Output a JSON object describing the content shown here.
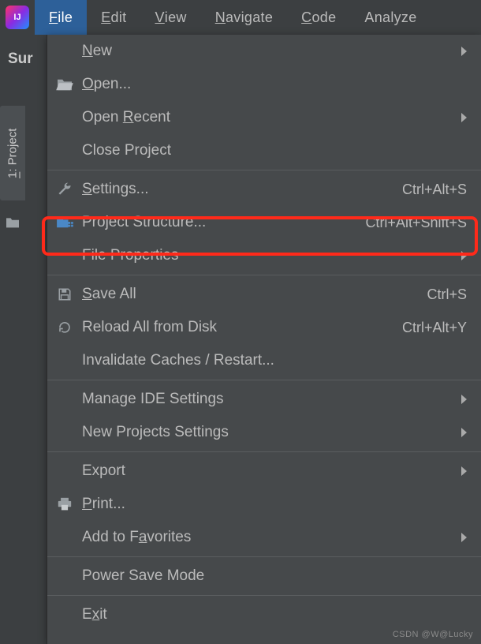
{
  "app": {
    "logo_text": "IJ"
  },
  "menubar": {
    "file_u": "F",
    "file_r": "ile",
    "edit_u": "E",
    "edit_r": "dit",
    "view_u": "V",
    "view_r": "iew",
    "nav_u": "N",
    "nav_r": "avigate",
    "code_u": "C",
    "code_r": "ode",
    "analyze": "Analyze"
  },
  "sidebar": {
    "truncated_text": "Sur",
    "project_tab_num": "1",
    "project_tab_text": ": Project"
  },
  "menu": {
    "new_u": "N",
    "new_r": "ew",
    "open_u": "O",
    "open_r": "pen...",
    "open_recent_a": "Open ",
    "open_recent_u": "R",
    "open_recent_b": "ecent",
    "close_project": "Close Project",
    "settings_u": "S",
    "settings_r": "ettings...",
    "settings_short": "Ctrl+Alt+S",
    "project_structure": "Project Structure...",
    "project_structure_short": "Ctrl+Alt+Shift+S",
    "file_properties": "File Properties",
    "save_all_u": "S",
    "save_all_r": "ave All",
    "save_all_short": "Ctrl+S",
    "reload": "Reload All from Disk",
    "reload_short": "Ctrl+Alt+Y",
    "invalidate": "Invalidate Caches / Restart...",
    "manage_ide": "Manage IDE Settings",
    "new_projects": "New Projects Settings",
    "export": "Export",
    "print_u": "P",
    "print_r": "rint...",
    "add_fav_a": "Add to F",
    "add_fav_u": "a",
    "add_fav_b": "vorites",
    "power_save": "Power Save Mode",
    "exit_a": "E",
    "exit_u": "x",
    "exit_b": "it"
  },
  "watermark": "CSDN @W@Lucky"
}
